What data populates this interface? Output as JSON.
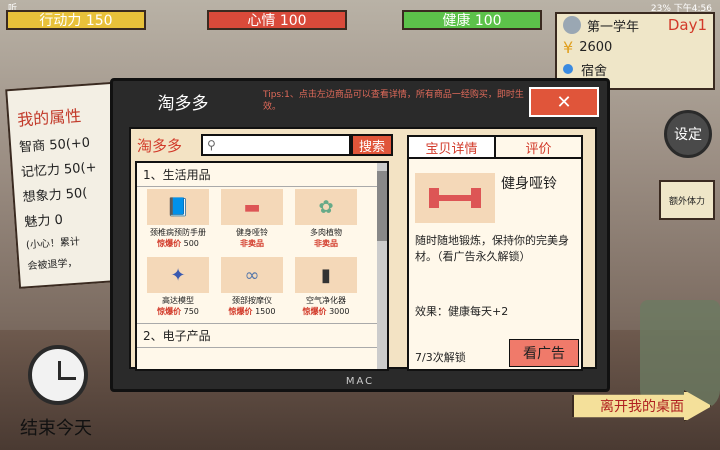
{
  "statusbar": {
    "left": "听",
    "right": "23% 下午4:56"
  },
  "stats": {
    "action": "行动力 150",
    "mood": "心情 100",
    "health": "健康 100"
  },
  "info": {
    "year": "第一学年",
    "day": "Day1",
    "money": "2600",
    "location": "宿舍",
    "yen": "¥"
  },
  "note": {
    "title": "我的属性",
    "lines": [
      "智商  50(+0",
      "记忆力 50(+",
      "想象力 50(",
      "魅力 0",
      "(小心！累计",
      "会被退学，"
    ]
  },
  "settings_label": "设定",
  "tv_label": "额外体力",
  "end_day": "结束今天",
  "leave_label": "离开我的桌面",
  "modal": {
    "title": "淘多多",
    "tips": "Tips:1、点击左边商品可以查看详情，所有商品一经购买，即时生效。",
    "close": "✕",
    "footer": "MAC",
    "shop_name": "淘多多",
    "search_placeholder": "",
    "search_btn": "搜索",
    "categories": [
      {
        "title": "1、生活用品",
        "items": [
          {
            "name": "颈椎病预防手册",
            "prlabel": "惊爆价",
            "price": "500",
            "icon": "📘"
          },
          {
            "name": "健身哑铃",
            "prlabel": "非卖品",
            "price": "",
            "icon": "▬"
          },
          {
            "name": "多肉植物",
            "prlabel": "非卖品",
            "price": "",
            "icon": "✿"
          },
          {
            "name": "高达模型",
            "prlabel": "惊爆价",
            "price": "750",
            "icon": "✦"
          },
          {
            "name": "颈部按摩仪",
            "prlabel": "惊爆价",
            "price": "1500",
            "icon": "∞"
          },
          {
            "name": "空气净化器",
            "prlabel": "惊爆价",
            "price": "3000",
            "icon": "▮"
          }
        ]
      },
      {
        "title": "2、电子产品"
      }
    ],
    "detail": {
      "tab1": "宝贝详情",
      "tab2": "评价",
      "name": "健身哑铃",
      "desc": "随时随地锻炼，保持你的完美身材。（看广告永久解锁）",
      "effect": "效果：健康每天+2",
      "unlock": "7/3次解锁",
      "ad_btn": "看广告"
    }
  }
}
